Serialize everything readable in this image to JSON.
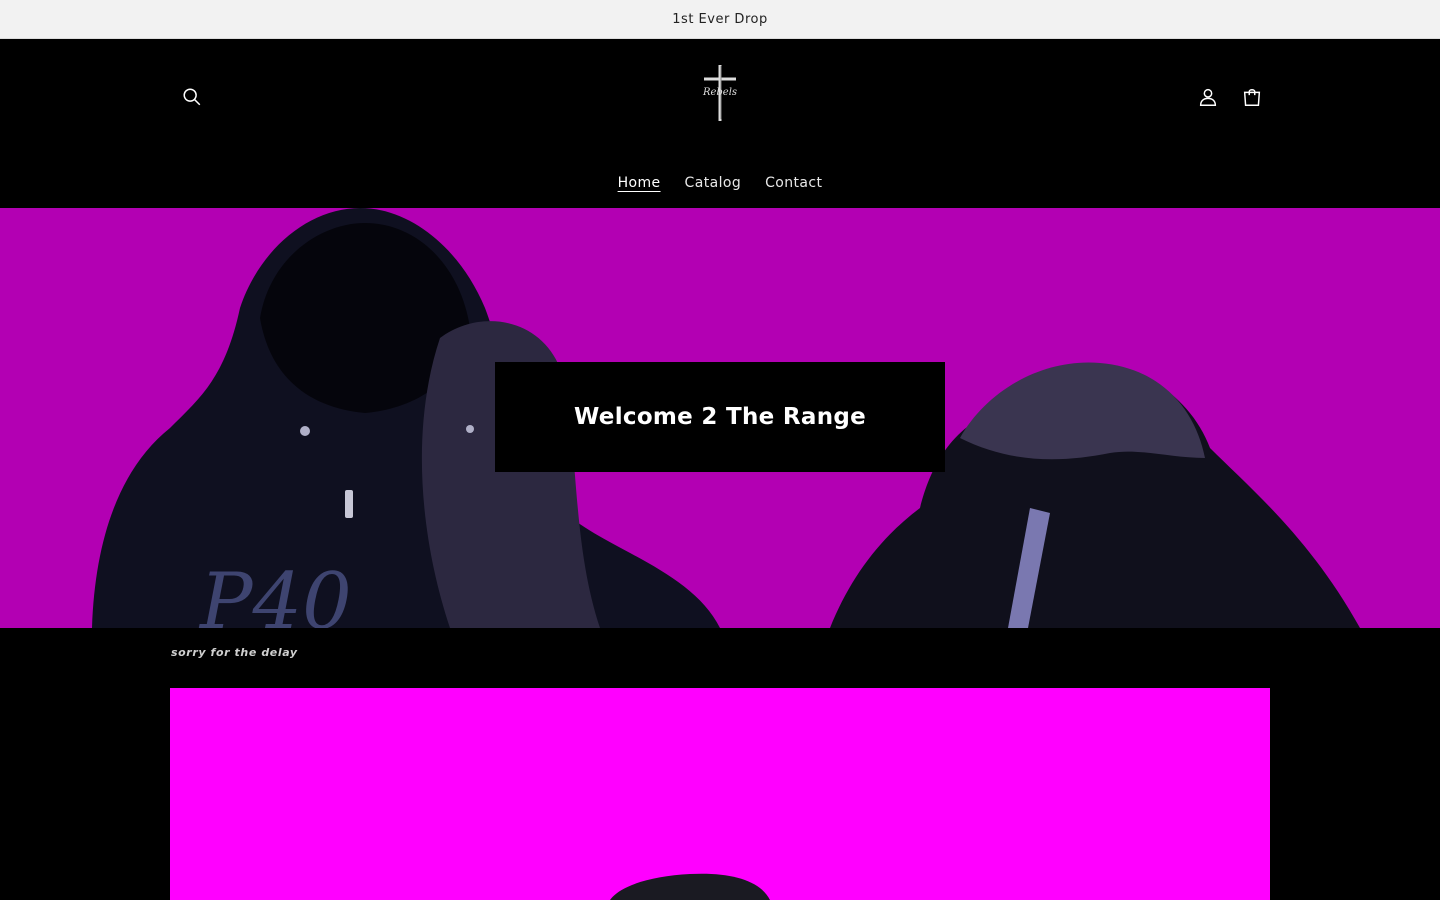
{
  "announcement": {
    "text": "1st Ever Drop"
  },
  "header": {
    "logo_text": "Rebels",
    "icons": {
      "search": "search-icon",
      "account": "user-icon",
      "cart": "cart-icon"
    }
  },
  "nav": {
    "items": [
      {
        "label": "Home",
        "active": true
      },
      {
        "label": "Catalog",
        "active": false
      },
      {
        "label": "Contact",
        "active": false
      }
    ]
  },
  "hero": {
    "heading": "Welcome 2 The Range",
    "background_color": "#b300b3",
    "hoodie_print": "P40"
  },
  "caption": {
    "text": "sorry for the delay"
  },
  "feature": {
    "background_color": "#ff00ff"
  }
}
